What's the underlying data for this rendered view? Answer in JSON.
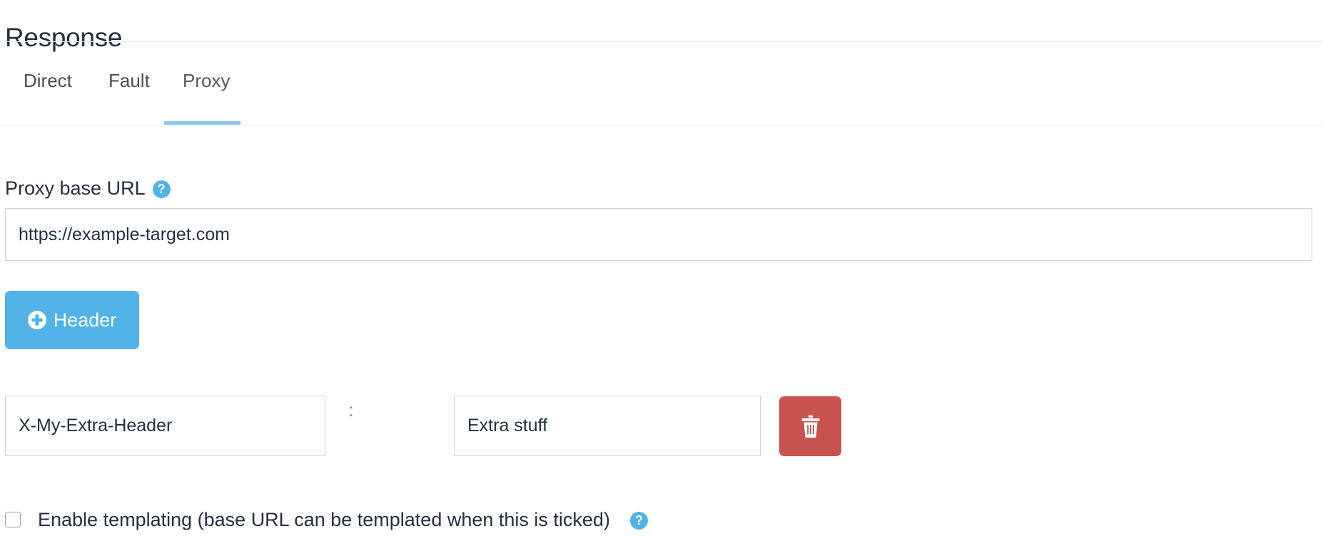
{
  "page": {
    "title": "Response"
  },
  "tabs": {
    "items": [
      {
        "label": "Direct",
        "active": false
      },
      {
        "label": "Fault",
        "active": false
      },
      {
        "label": "Proxy",
        "active": true
      }
    ],
    "active_index": 2,
    "underline_color": "#8ec8ef"
  },
  "proxy": {
    "base_url_label": "Proxy base URL",
    "base_url_help_icon": "help-circle-icon",
    "base_url_help_glyph": "?",
    "base_url_value": "https://example-target.com",
    "base_url_placeholder": "Proxy base URL"
  },
  "add_header_button": {
    "label": "Header",
    "icon": "plus-circle-icon",
    "color": "#52b3e9"
  },
  "headers": {
    "separator": ":",
    "rows": [
      {
        "key": "X-My-Extra-Header",
        "key_placeholder": "Header name",
        "value": "Extra stuff",
        "value_placeholder": "Header value",
        "delete_icon": "trash-icon",
        "delete_color": "#c9534f"
      }
    ]
  },
  "templating": {
    "checked": false,
    "label": "Enable templating (base URL can be templated when this is ticked)",
    "help_icon": "help-circle-icon",
    "help_glyph": "?"
  },
  "colors": {
    "accent_blue": "#52b3e9",
    "tab_underline": "#8ec8ef",
    "danger_red": "#c9534f",
    "text_dark": "#252f41",
    "border_grey": "#cfd2d6"
  }
}
